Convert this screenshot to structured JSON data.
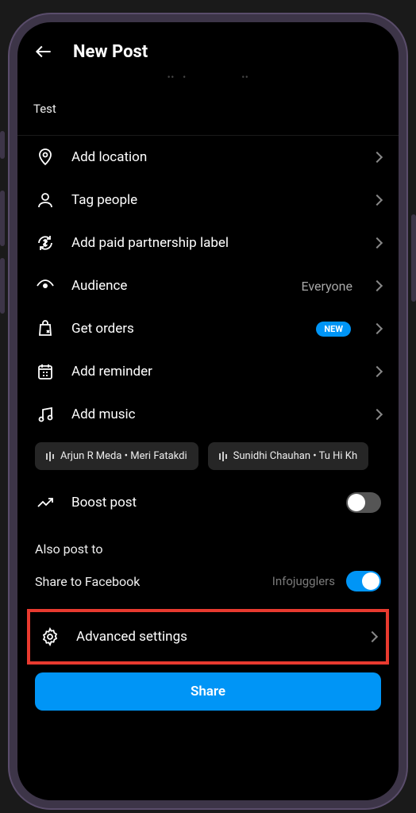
{
  "header": {
    "title": "New Post"
  },
  "caption": {
    "text": "Test"
  },
  "rows": {
    "location": {
      "label": "Add location"
    },
    "tag": {
      "label": "Tag people"
    },
    "paid": {
      "label": " Add paid partnership label"
    },
    "audience": {
      "label": "Audience",
      "value": "Everyone"
    },
    "orders": {
      "label": "Get orders",
      "badge": "NEW"
    },
    "reminder": {
      "label": "Add reminder"
    },
    "music": {
      "label": "Add music"
    },
    "boost": {
      "label": "Boost post"
    },
    "advanced": {
      "label": "Advanced settings"
    }
  },
  "music_suggestions": [
    "Arjun R Meda • Meri Fatakdi",
    "Sunidhi Chauhan • Tu Hi Kh"
  ],
  "crosspost": {
    "section_title": "Also post to",
    "facebook_label": "Share to Facebook",
    "facebook_account": "Infojugglers"
  },
  "share_button": "Share"
}
